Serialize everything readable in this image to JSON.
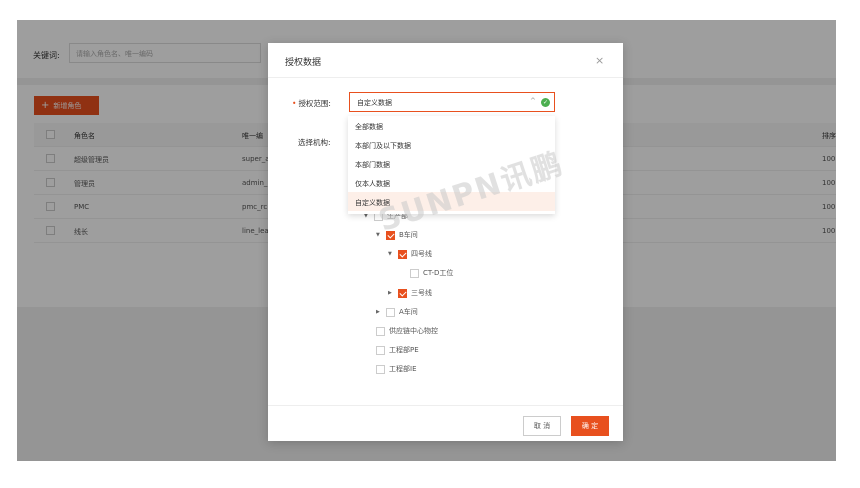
{
  "search": {
    "label": "关键词:",
    "placeholder": "请输入角色名、唯一编码"
  },
  "toolbar": {
    "add_label": "新增角色"
  },
  "table": {
    "headers": [
      "角色名",
      "唯一编",
      "排序"
    ],
    "rows": [
      [
        "超级管理员",
        "super_a",
        "100"
      ],
      [
        "管理员",
        "admin_",
        "100"
      ],
      [
        "PMC",
        "pmc_rc",
        "100"
      ],
      [
        "线长",
        "line_lea",
        "100"
      ]
    ]
  },
  "modal": {
    "title": "授权数据",
    "close_icon": "×",
    "scope_label": "授权范围:",
    "scope_value": "自定义数据",
    "org_label": "选择机构:",
    "options": [
      "全部数据",
      "本部门及以下数据",
      "本部门数据",
      "仅本人数据",
      "自定义数据"
    ],
    "selected_option": "自定义数据",
    "tree": [
      {
        "label": "生产部",
        "checked": false,
        "expanded": true
      },
      {
        "label": "B车间",
        "checked": true,
        "expanded": true
      },
      {
        "label": "四号线",
        "checked": true,
        "expanded": true
      },
      {
        "label": "CT-D工位",
        "checked": false,
        "expanded": false
      },
      {
        "label": "三号线",
        "checked": true,
        "expanded": false
      },
      {
        "label": "A车间",
        "checked": false,
        "expanded": false
      },
      {
        "label": "供应链中心物控",
        "checked": false,
        "expanded": false
      },
      {
        "label": "工程部PE",
        "checked": false,
        "expanded": false
      },
      {
        "label": "工程部IE",
        "checked": false,
        "expanded": false
      }
    ],
    "cancel_label": "取 消",
    "ok_label": "确 定"
  },
  "watermark": "SUNPN讯鹏",
  "colors": {
    "accent": "#e8501e",
    "success": "#4caf50"
  },
  "icons": {
    "plus": "+",
    "caret_up": "^",
    "check": "✓",
    "expand": "▼",
    "collapse": "▶"
  }
}
